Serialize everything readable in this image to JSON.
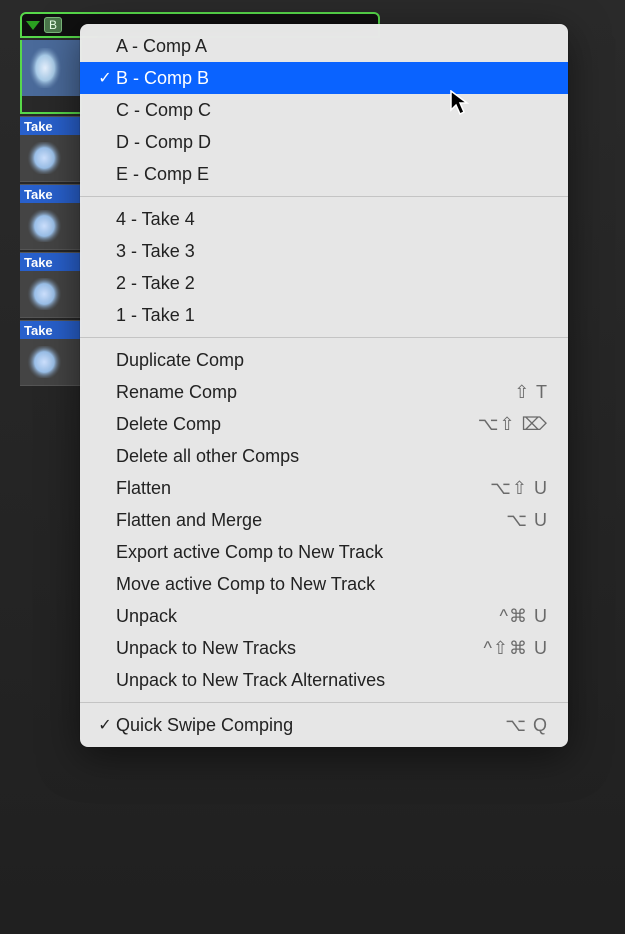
{
  "folder": {
    "badge": "B"
  },
  "tracks": {
    "take4": "Take",
    "take3": "Take",
    "take2": "Take",
    "take1": "Take"
  },
  "menu": {
    "compA": "A - Comp A",
    "compB": "B - Comp B",
    "compC": "C - Comp C",
    "compD": "D - Comp D",
    "compE": "E - Comp E",
    "take4": "4 - Take 4",
    "take3": "3 - Take 3",
    "take2": "2 - Take 2",
    "take1": "1 - Take 1",
    "duplicate": "Duplicate Comp",
    "rename": "Rename Comp",
    "delete": "Delete Comp",
    "deleteOthers": "Delete all other Comps",
    "flatten": "Flatten",
    "flattenMerge": "Flatten and Merge",
    "exportNew": "Export active Comp to New Track",
    "moveNew": "Move active Comp to New Track",
    "unpack": "Unpack",
    "unpackTracks": "Unpack to New Tracks",
    "unpackAlts": "Unpack to New Track Alternatives",
    "quickSwipe": "Quick Swipe Comping"
  },
  "shortcuts": {
    "rename": "⇧ T",
    "delete": "⌥⇧ ⌦",
    "flatten": "⌥⇧ U",
    "flattenMerge": "⌥ U",
    "unpack": "^⌘ U",
    "unpackTracks": "^⇧⌘ U",
    "quickSwipe": "⌥ Q"
  },
  "checks": {
    "check": "✓"
  }
}
